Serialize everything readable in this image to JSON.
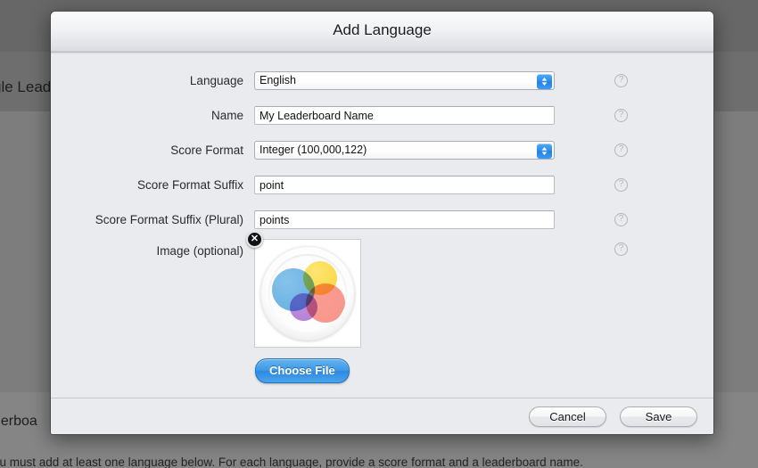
{
  "background": {
    "heading_partial": "gle Lead",
    "subheading_partial": "derboa",
    "note_partial": "ou must add at least one language below. For each language, provide a score format and a leaderboard name."
  },
  "dialog": {
    "title": "Add Language",
    "help_icon": "?",
    "fields": [
      {
        "label": "Language",
        "type": "select",
        "value": "English",
        "name": "language",
        "help": "?"
      },
      {
        "label": "Name",
        "type": "text",
        "value": "My Leaderboard Name",
        "placeholder": "",
        "name": "name",
        "help": "?"
      },
      {
        "label": "Score Format",
        "type": "select",
        "value": "Integer (100,000,122)",
        "name": "score-format",
        "help": "?"
      },
      {
        "label": "Score Format Suffix",
        "type": "text",
        "value": "point",
        "placeholder": "",
        "name": "score-format-suffix",
        "help": "?"
      },
      {
        "label": "Score Format Suffix (Plural)",
        "type": "text",
        "value": "points",
        "placeholder": "",
        "name": "score-format-suffix-plural",
        "help": "?"
      }
    ],
    "image_field": {
      "label": "Image (optional)",
      "remove_glyph": "✕",
      "choose_file_label": "Choose File",
      "help": "?"
    },
    "footer": {
      "cancel_label": "Cancel",
      "save_label": "Save"
    }
  },
  "colors": {
    "accent_blue": "#2e8ae1",
    "dialog_body": "#e9ebee",
    "icon_blue": "#4fa3dd",
    "icon_yellow": "#f8d426",
    "icon_red": "#f87d6e",
    "icon_purple": "#a05fc9"
  }
}
